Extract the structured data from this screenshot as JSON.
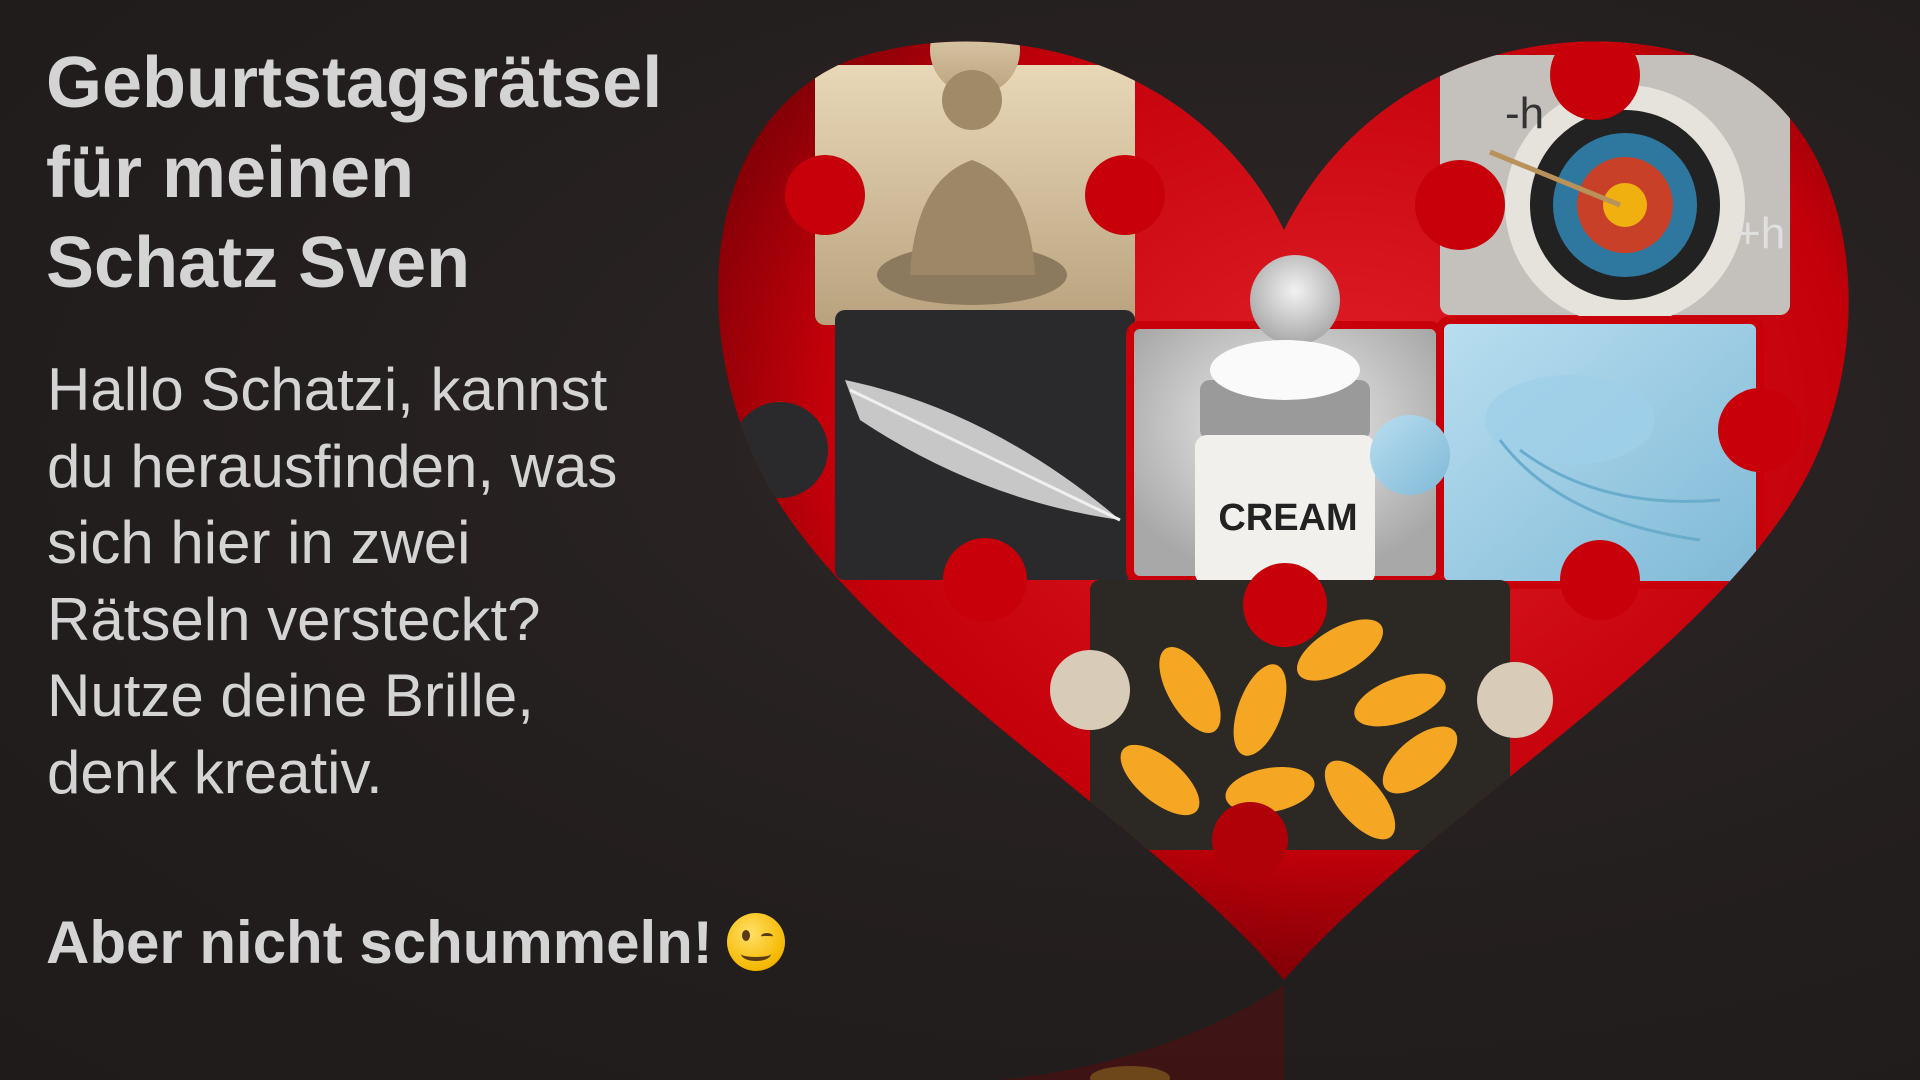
{
  "title": {
    "lines": [
      "Geburtstagsrätsel",
      "für meinen",
      "Schatz Sven"
    ]
  },
  "message": {
    "lines": [
      "Hallo Schatzi, kannst",
      "du herausfinden, was",
      "sich hier in zwei",
      "Rätseln versteckt?",
      "Nutze deine Brille,",
      "denk kreativ."
    ]
  },
  "closing": {
    "text": "Aber nicht schummeln!",
    "emoji": "winking-face"
  },
  "puzzle": {
    "cream_label": "CREAM",
    "target_minus_label": "-h",
    "target_plus_label": "+h"
  },
  "colors": {
    "background": "#231e1e",
    "heart": "#c8000a",
    "text": "#d4d4d4"
  }
}
